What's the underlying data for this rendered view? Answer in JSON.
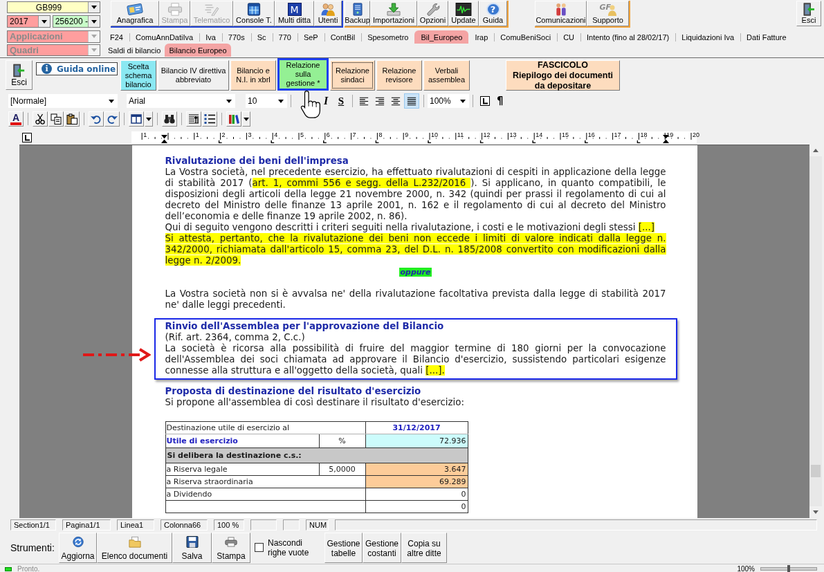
{
  "selectors": {
    "company": {
      "value": "GB999"
    },
    "year": {
      "value": "2017"
    },
    "code": {
      "value": "256200 -"
    },
    "application": {
      "value": "Applicazioni",
      "disabled": true
    },
    "section": {
      "value": "Quadri",
      "disabled": true
    }
  },
  "main_toolbar": [
    {
      "buttons": [
        {
          "label": "Anagrafica",
          "disabled": false
        },
        {
          "label": "Stampa",
          "disabled": true
        },
        {
          "label": "Telematico",
          "disabled": true
        },
        {
          "label": "Console T.",
          "disabled": false
        },
        {
          "label": "Multi ditta",
          "disabled": false,
          "icon_text": "M"
        },
        {
          "label": "Utenti",
          "disabled": false
        }
      ]
    },
    {
      "buttons": [
        {
          "label": "Backup",
          "disabled": false
        },
        {
          "label": "Importazioni",
          "disabled": false
        },
        {
          "label": "Opzioni",
          "disabled": false
        },
        {
          "label": "Update",
          "disabled": false
        },
        {
          "label": "Guida",
          "disabled": false,
          "icon_text": "?"
        }
      ]
    },
    {
      "buttons": [
        {
          "label": "Comunicazioni",
          "disabled": false
        },
        {
          "label": "Supporto",
          "disabled": false,
          "icon_text": "GF"
        }
      ]
    },
    {
      "buttons": [
        {
          "label": "Esci",
          "disabled": false
        }
      ]
    }
  ],
  "app_tabs": [
    {
      "label": "F24",
      "selected": false
    },
    {
      "label": "ComuAnnDatiIva",
      "selected": false
    },
    {
      "label": "Iva",
      "selected": false
    },
    {
      "label": "770s",
      "selected": false
    },
    {
      "label": "Sc",
      "selected": false
    },
    {
      "label": "770",
      "selected": false
    },
    {
      "label": "SeP",
      "selected": false
    },
    {
      "label": "ContBil",
      "selected": false
    },
    {
      "label": "Spesometro",
      "selected": false
    },
    {
      "label": "Bil_Europeo",
      "selected": true
    },
    {
      "label": "Irap",
      "selected": false
    },
    {
      "label": "ComuBeniSoci",
      "selected": false
    },
    {
      "label": "CU",
      "selected": false
    },
    {
      "label": "Intento (fino al 28/02/17)",
      "selected": false
    },
    {
      "label": "Liquidazioni Iva",
      "selected": false
    },
    {
      "label": "Dati Fatture",
      "selected": false
    }
  ],
  "sub_tabs": [
    {
      "label": "Saldi di bilancio",
      "selected": false
    },
    {
      "label": "Bilancio Europeo",
      "selected": true
    }
  ],
  "document_toolbar": {
    "exit_button": {
      "label": "Esci"
    },
    "help_button": {
      "label": "Guida online",
      "icon_text": "i"
    },
    "documents": [
      {
        "label": "Scelta schema bilancio",
        "kind": "document",
        "color": "#8ae8f2",
        "selected": false,
        "focused": false
      },
      {
        "label": "Bilancio IV direttiva abbreviato",
        "kind": "document",
        "color": "#f0f0f0",
        "selected": false,
        "focused": false
      },
      {
        "label": "Bilancio e N.I. in xbrl",
        "kind": "document",
        "color": "#fddcbe",
        "selected": false,
        "focused": false
      },
      {
        "label": "Relazione sulla gestione *",
        "kind": "document",
        "color": "#94f094",
        "selected": true,
        "focused": false
      },
      {
        "label": "Relazione sindaci",
        "kind": "document",
        "color": "#fddcbe",
        "selected": false,
        "focused": true
      },
      {
        "label": "Relazione revisore",
        "kind": "document",
        "color": "#fddcbe",
        "selected": false,
        "focused": false
      },
      {
        "label": "Verbali assemblea",
        "kind": "document",
        "color": "#fddcbe",
        "selected": false,
        "focused": false
      },
      {
        "label": "FASCICOLO",
        "sublabel": "Riepilogo dei documenti da depositare",
        "kind": "summary",
        "color": "#fddcbe",
        "selected": false,
        "focused": false
      }
    ]
  },
  "format_toolbar": {
    "style": {
      "value": "[Normale]"
    },
    "font": {
      "value": "Arial"
    },
    "size": {
      "value": "10"
    },
    "text_buttons": [
      {
        "label": "I"
      },
      {
        "label": "S"
      }
    ],
    "alignment": [
      {
        "selected": false
      },
      {
        "selected": false
      },
      {
        "selected": false
      },
      {
        "selected": true
      }
    ],
    "zoom": {
      "value": "100%"
    },
    "pilcrow": {
      "label": "¶"
    },
    "font_color": {
      "label": "A"
    }
  },
  "ruler": {
    "labels": [
      "1",
      "1",
      "2",
      "3",
      "4",
      "5",
      "6",
      "7",
      "8",
      "9",
      "10",
      "11",
      "12",
      "13",
      "14",
      "15",
      "16",
      "17",
      "18",
      "19",
      "20"
    ]
  },
  "document": {
    "blocks": [
      {
        "kind": "heading",
        "text": "Rivalutazione dei beni dell'impresa"
      },
      {
        "kind": "paragraph",
        "runs": [
          {
            "text": "La Vostra società, nel precedente esercizio, ha effettuato rivalutazioni di cespiti in applicazione della legge di stabilità 2017 (",
            "highlight": false
          },
          {
            "text": "art. 1, commi 556 e segg. della L.232/2016 ",
            "highlight": true
          },
          {
            "text": "). Si applicano, in quanto compatibili, le disposizioni degli articoli della legge 21 novembre 2000, n. 342 (quindi per prassi il regolamento di cui al decreto del Ministro delle finanze 13 aprile 2001, n. 162 e il regolamento di cui al decreto del Ministro dell’economia e delle finanze 19 aprile 2002, n. 86).",
            "highlight": false
          }
        ]
      },
      {
        "kind": "paragraph",
        "runs": [
          {
            "text": "Qui di seguito vengono descritti i criteri seguiti nella rivalutazione, i costi e le motivazioni degli stessi ",
            "highlight": false
          },
          {
            "text": "[...]",
            "highlight": true
          }
        ]
      },
      {
        "kind": "paragraph",
        "runs": [
          {
            "text": "Si attesta, pertanto, che la rivalutazione dei beni non eccede i limiti di valore indicati dalla legge n. 342/2000, richiamata dall'articolo 15, comma 23, del D.L. n. 185/2008 convertito con modificazioni dalla legge n. 2/2009. ",
            "highlight": true
          }
        ]
      },
      {
        "kind": "alternative",
        "text": "oppure"
      },
      {
        "kind": "paragraph",
        "runs": [
          {
            "text": "La Vostra società non si è avvalsa ne' della rivalutazione facoltativa prevista dalla legge di stabilità 2017 ne' dalle leggi precedenti.",
            "highlight": false
          }
        ]
      },
      {
        "kind": "frame",
        "blocks": [
          {
            "kind": "heading",
            "text": "Rinvio dell'Assemblea per l'approvazione del Bilancio"
          },
          {
            "kind": "paragraph",
            "runs": [
              {
                "text": "(Rif. art. 2364, comma 2, C.c.)",
                "highlight": false
              }
            ]
          },
          {
            "kind": "paragraph",
            "runs": [
              {
                "text": "La società è ricorsa alla possibilità di fruire del maggior termine di 180 giorni per la convocazione dell'Assemblea dei soci chiamata ad approvare il Bilancio d'esercizio, sussistendo particolari esigenze connesse alla struttura e all'oggetto della società, quali ",
                "highlight": false
              },
              {
                "text": "[...].",
                "highlight": true
              }
            ]
          }
        ]
      },
      {
        "kind": "heading",
        "text": "Proposta di destinazione del risultato d'esercizio"
      },
      {
        "kind": "paragraph",
        "runs": [
          {
            "text": "Si propone all'assemblea di così destinare il risultato d'esercizio:",
            "highlight": false
          }
        ]
      },
      {
        "kind": "table",
        "rows": [
          {
            "kind": "caption",
            "label": "Destinazione utile di esercizio al",
            "value": "31/12/2017",
            "shaded": false
          },
          {
            "kind": "profit",
            "label": "Utile di esercizio",
            "percent": "%",
            "value": "72.936",
            "shaded": true
          },
          {
            "kind": "section",
            "label": "Si delibera la destinazione c.s.:"
          },
          {
            "kind": "item",
            "label": "a Riserva legale",
            "percent": "5,0000",
            "value": "3.647",
            "shaded": true
          },
          {
            "kind": "item",
            "label": "a Riserva straordinaria",
            "value": "69.289",
            "shaded": true
          },
          {
            "kind": "item",
            "label": "a Dividendo",
            "value": "0",
            "shaded": false
          },
          {
            "kind": "item",
            "value": "0",
            "shaded": false
          }
        ]
      }
    ]
  },
  "status_panes": [
    {
      "kind": "text",
      "text": "Section1/1"
    },
    {
      "kind": "text",
      "text": "Pagina1/1"
    },
    {
      "kind": "text",
      "text": "Linea1"
    },
    {
      "kind": "text",
      "text": "Colonna66"
    },
    {
      "kind": "text",
      "text": "100 %"
    },
    {
      "kind": "blank"
    },
    {
      "kind": "blank"
    },
    {
      "kind": "text",
      "text": "NUM"
    },
    {
      "kind": "blank"
    }
  ],
  "tools": {
    "title": "Strumenti:",
    "items": [
      {
        "kind": "iconbutton",
        "label": "Aggiorna"
      },
      {
        "kind": "iconbutton",
        "label": "Elenco documenti"
      },
      {
        "kind": "iconbutton",
        "label": "Salva"
      },
      {
        "kind": "iconbutton",
        "label": "Stampa"
      },
      {
        "kind": "checkbox",
        "label": "Nascondi righe vuote",
        "checked": false
      },
      {
        "kind": "button",
        "label": "Gestione tabelle"
      },
      {
        "kind": "button",
        "label": "Gestione costanti"
      },
      {
        "kind": "button",
        "label": "Copia su altre ditte"
      }
    ]
  },
  "status_bar": {
    "message": "Pronto.",
    "zoom": "100%",
    "zoom_slider": {
      "level": 0.5
    }
  }
}
